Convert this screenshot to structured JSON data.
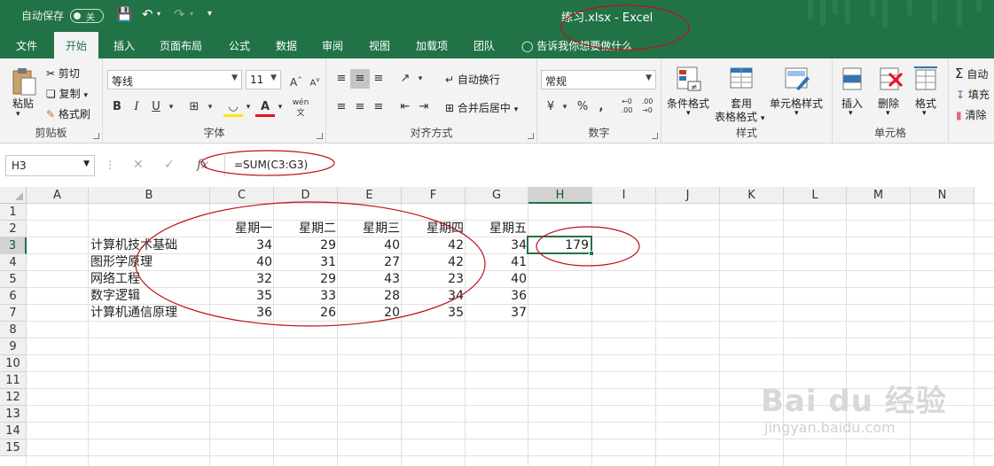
{
  "titlebar": {
    "autosave_label": "自动保存",
    "autosave_state": "关",
    "doc_title": "练习.xlsx  -  Excel"
  },
  "tabs": [
    "文件",
    "开始",
    "插入",
    "页面布局",
    "公式",
    "数据",
    "审阅",
    "视图",
    "加载项",
    "团队"
  ],
  "active_tab": "开始",
  "tell_me": "告诉我你想要做什么",
  "ribbon": {
    "clipboard": {
      "label": "剪贴板",
      "paste": "粘贴",
      "cut": "剪切",
      "copy": "复制",
      "format_painter": "格式刷"
    },
    "font": {
      "label": "字体",
      "font_name": "等线",
      "font_size": "11",
      "bold": "B",
      "italic": "I",
      "underline": "U",
      "phonetic": "wén"
    },
    "alignment": {
      "label": "对齐方式",
      "wrap": "自动换行",
      "merge": "合并后居中"
    },
    "number": {
      "label": "数字",
      "format": "常规"
    },
    "styles": {
      "label": "样式",
      "conditional": "条件格式",
      "table_format_1": "套用",
      "table_format_2": "表格格式",
      "cell_styles": "单元格样式"
    },
    "cells": {
      "label": "单元格",
      "insert": "插入",
      "delete": "删除",
      "format": "格式"
    },
    "editing": {
      "autosum": "自动",
      "fill": "填充",
      "clear": "清除"
    }
  },
  "formula_bar": {
    "name_box": "H3",
    "formula": "=SUM(C3:G3)"
  },
  "columns": [
    "A",
    "B",
    "C",
    "D",
    "E",
    "F",
    "G",
    "H",
    "I",
    "J",
    "K",
    "L",
    "M",
    "N"
  ],
  "rows": [
    "1",
    "2",
    "3",
    "4",
    "5",
    "6",
    "7",
    "8",
    "9",
    "10",
    "11",
    "12",
    "13",
    "14",
    "15"
  ],
  "selected_cell": "H3",
  "sheet": {
    "day_headers": [
      "星期一",
      "星期二",
      "星期三",
      "星期四",
      "星期五"
    ],
    "subjects": [
      {
        "name": "计算机技术基础",
        "scores": [
          "34",
          "29",
          "40",
          "42",
          "34"
        ]
      },
      {
        "name": "图形学原理",
        "scores": [
          "40",
          "31",
          "27",
          "42",
          "41"
        ]
      },
      {
        "name": "网络工程",
        "scores": [
          "32",
          "29",
          "43",
          "23",
          "40"
        ]
      },
      {
        "name": "数字逻辑",
        "scores": [
          "35",
          "33",
          "28",
          "34",
          "36"
        ]
      },
      {
        "name": "计算机通信原理",
        "scores": [
          "36",
          "26",
          "20",
          "35",
          "37"
        ]
      }
    ],
    "h3_value": "179"
  },
  "annotation_color": "#c0101a",
  "accent_color": "#217346",
  "watermark": {
    "brand": "Bai du 经验",
    "url": "jingyan.baidu.com"
  }
}
